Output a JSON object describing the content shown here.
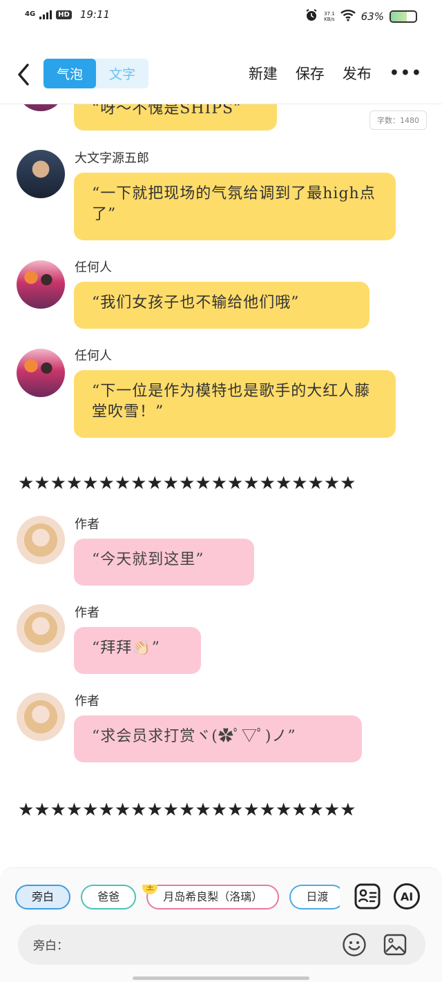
{
  "status_bar": {
    "network": "4G",
    "hd": "HD",
    "time": "19:11",
    "speed_value": "37.1",
    "speed_unit": "KB/s",
    "battery": "63%",
    "battery_level": 0.63
  },
  "topbar": {
    "tabs": [
      "气泡",
      "文字"
    ],
    "active_tab": 0,
    "actions": {
      "new": "新建",
      "save": "保存",
      "publish": "发布",
      "more": "•••"
    }
  },
  "word_count": "字数：1480",
  "messages": [
    {
      "text": "“呀～不愧是SHIPS”"
    },
    {
      "name": "大文字源五郎",
      "text": "“一下就把现场的气氛给调到了最high点了”"
    },
    {
      "name": "任何人",
      "text": "“我们女孩子也不输给他们哦”"
    },
    {
      "name": "任何人",
      "text": "“下一位是作为模特也是歌手的大红人藤堂吹雪！”"
    },
    {
      "name": "作者",
      "text": "“今天就到这里”"
    },
    {
      "name": "作者",
      "text": "“拜拜👏🏻”"
    },
    {
      "name": "作者",
      "text": "“求会员求打赏ヾ(✿ﾟ▽ﾟ)ノ”"
    }
  ],
  "separator": "★★★★★★★★★★★★★★★★★★★★★",
  "bottom": {
    "roles": [
      "旁白",
      "爸爸",
      "月岛希良梨（洛璃）",
      "日渡"
    ],
    "lead_badge": "主",
    "input_label": "旁白："
  },
  "colors": {
    "accent": "#2aa3ea",
    "yellow_bubble": "#fedc6a",
    "pink_bubble": "#fdc8d6"
  }
}
